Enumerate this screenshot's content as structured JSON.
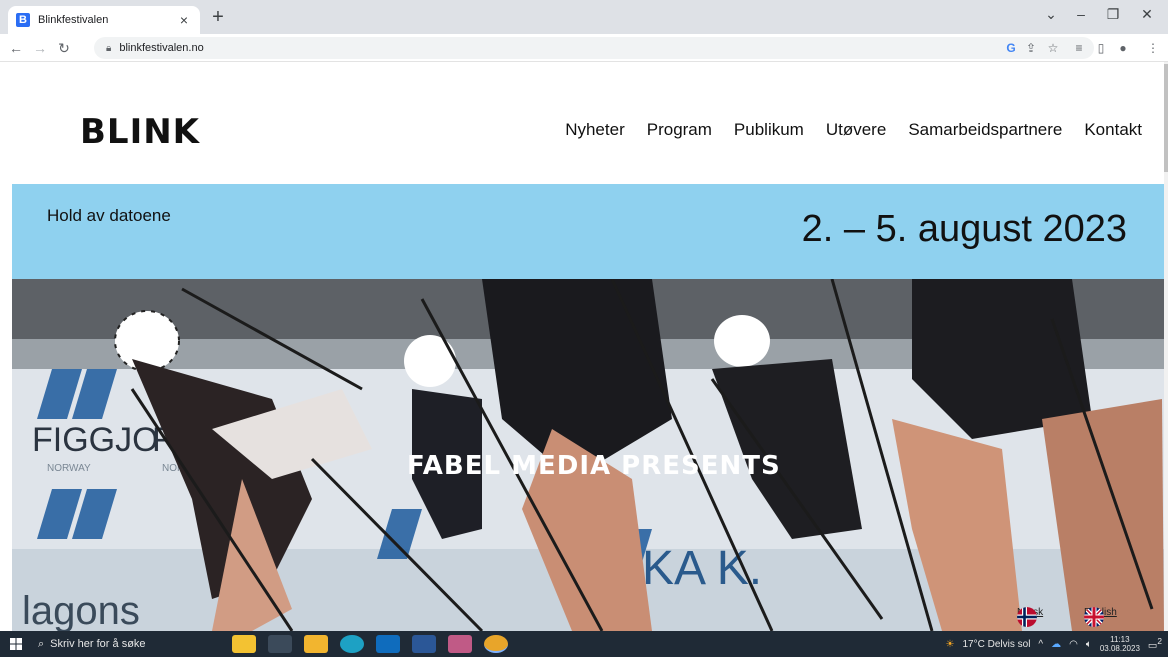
{
  "browser": {
    "tab_title": "Blinkfestivalen",
    "favicon_letter": "B",
    "url": "blinkfestivalen.no",
    "new_tab_symbol": "+",
    "close_symbol": "×",
    "window_controls": [
      "⌄",
      "–",
      "❐",
      "✕"
    ]
  },
  "site": {
    "logo": "BLINK",
    "nav": [
      "Nyheter",
      "Program",
      "Publikum",
      "Utøvere",
      "Samarbeidspartnere",
      "Kontakt"
    ],
    "date_band": {
      "label": "Hold av datoene",
      "dates": "2. – 5. august 2023",
      "color": "#8fd1ef"
    },
    "hero": {
      "overlay_text": "FABEL MEDIA PRESENTS",
      "languages": [
        "Norsk",
        "English"
      ]
    }
  },
  "taskbar": {
    "search_placeholder": "Skriv her for å søke",
    "weather": "17°C Delvis sol",
    "time": "11:13",
    "date": "03.08.2023",
    "notification_count": "2"
  }
}
